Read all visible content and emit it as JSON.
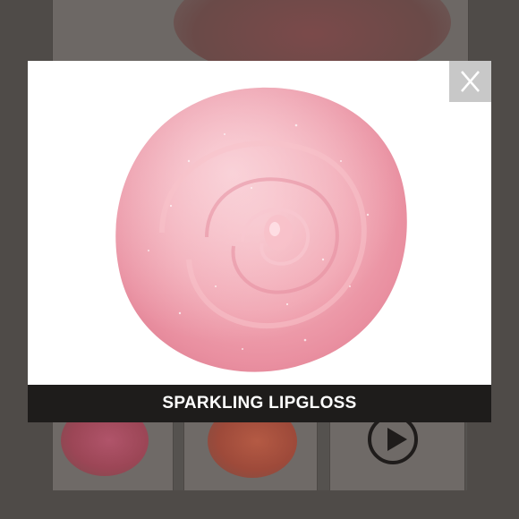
{
  "modal": {
    "caption": "SPARKLING LIPGLOSS",
    "close_icon": "close-icon",
    "product_image": "lipgloss-swatch",
    "colors": {
      "overlay": "#55524f",
      "caption_bar": "#1e1c1b",
      "close_button": "#c8c8c8",
      "gloss_main": "#f0a3b0"
    }
  },
  "background": {
    "thumbnails": [
      "berry-swatch",
      "coral-swatch",
      "play-video-icon"
    ]
  }
}
